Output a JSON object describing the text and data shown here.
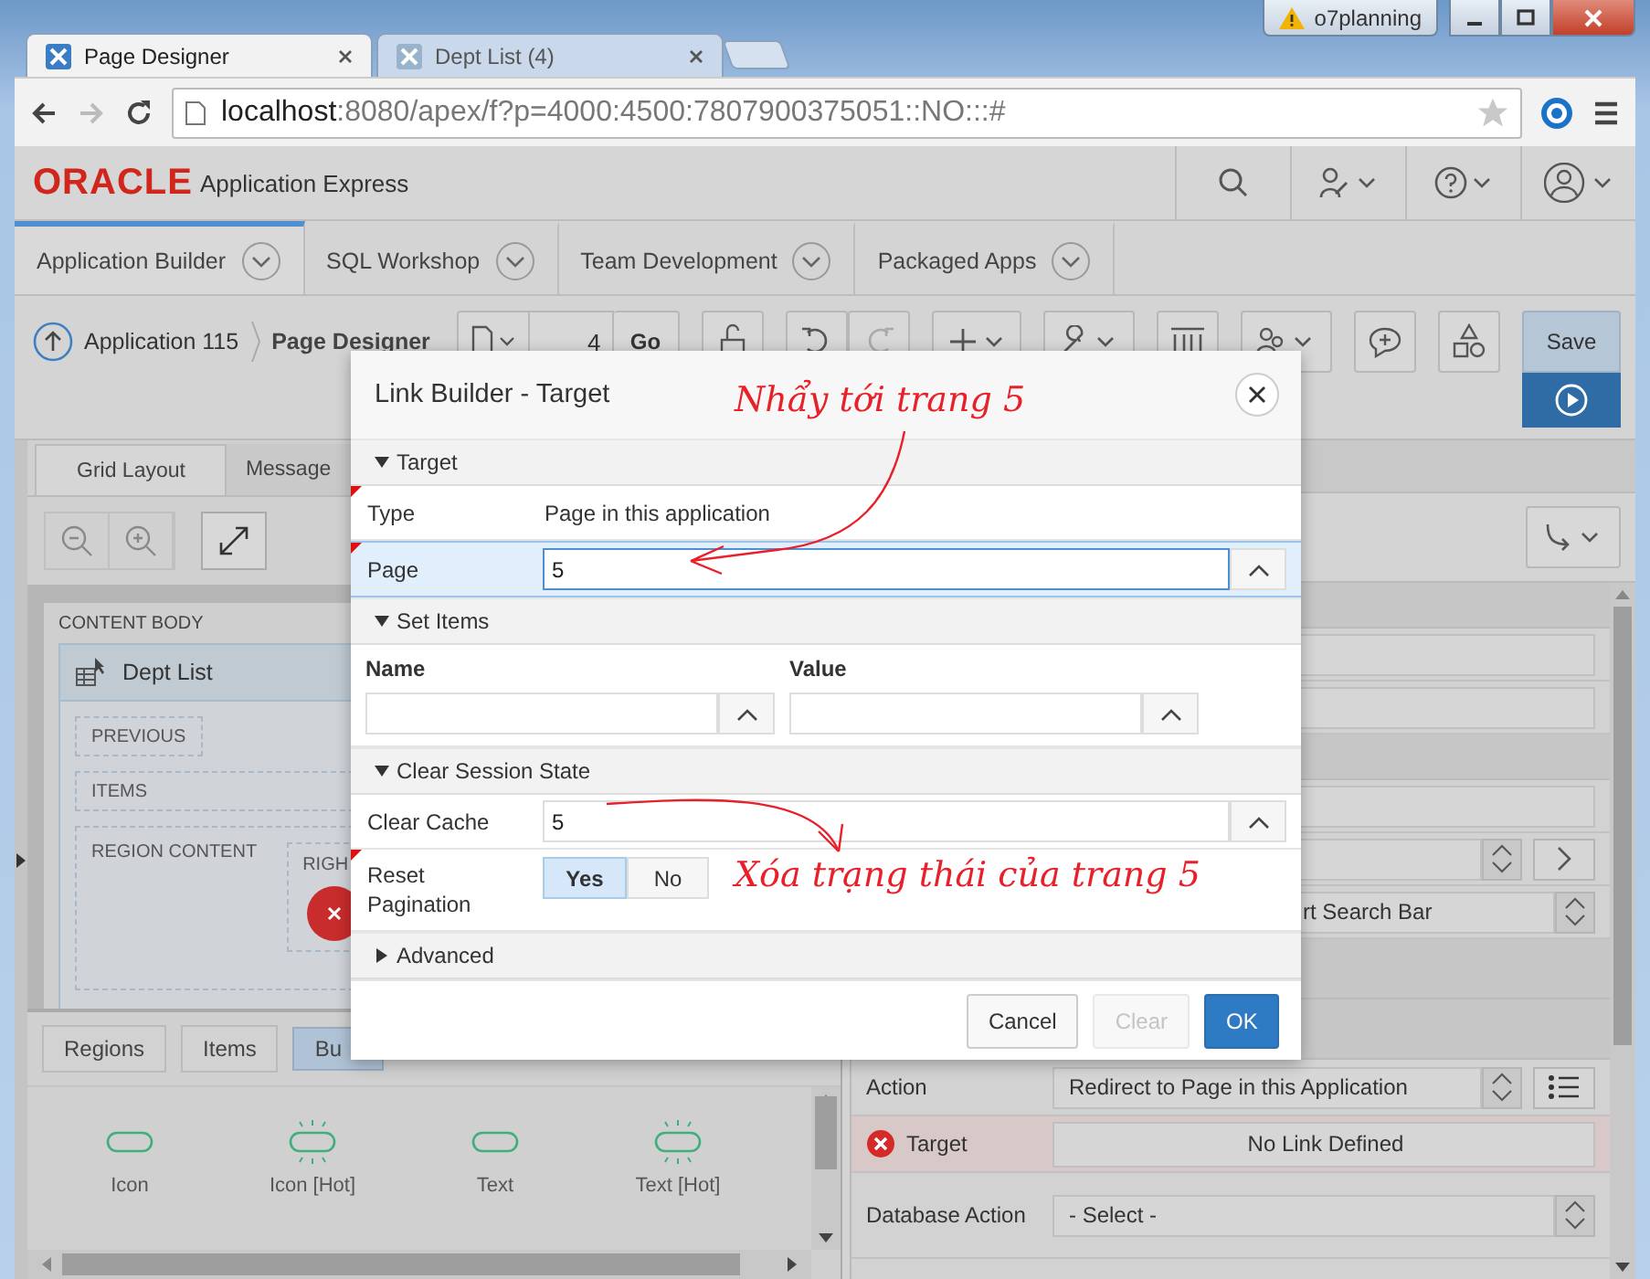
{
  "browser": {
    "tabs": [
      {
        "title": "Page Designer",
        "selected": true
      },
      {
        "title": "Dept List (4)",
        "selected": false
      }
    ],
    "profile_badge": "o7planning",
    "address": {
      "host": "localhost",
      "path": ":8080/apex/f?p=4000:4500:7807900375051::NO:::#"
    }
  },
  "header": {
    "logo": "ORACLE",
    "product": "Application Express"
  },
  "nav_tabs": [
    {
      "label": "Application Builder",
      "selected": true
    },
    {
      "label": "SQL Workshop",
      "selected": false
    },
    {
      "label": "Team Development",
      "selected": false
    },
    {
      "label": "Packaged Apps",
      "selected": false
    }
  ],
  "toolbar": {
    "breadcrumb": [
      "Application 115",
      "Page Designer"
    ],
    "page_number": "4",
    "go": "Go",
    "save": "Save"
  },
  "left_panel": {
    "tabs": [
      {
        "label": "Grid Layout",
        "selected": true
      },
      {
        "label": "Message",
        "selected": false
      }
    ],
    "layout": {
      "container": "CONTENT BODY",
      "region": "Dept List",
      "slots": [
        "PREVIOUS",
        "ITEMS",
        "REGION CONTENT"
      ],
      "sub_slot": "RIGH"
    },
    "gallery_tabs": [
      {
        "label": "Regions",
        "selected": false
      },
      {
        "label": "Items",
        "selected": false
      },
      {
        "label": "Bu",
        "selected": true
      }
    ],
    "gallery_items": [
      {
        "label": "Icon",
        "hot": false
      },
      {
        "label": "Icon [Hot]",
        "hot": true
      },
      {
        "label": "Text",
        "hot": false
      },
      {
        "label": "Text [Hot]",
        "hot": true
      }
    ]
  },
  "right_panel": {
    "partial_value": "rt Search Bar",
    "properties": [
      {
        "label": "Action",
        "kind": "select",
        "value": "Redirect to Page in this Application",
        "error": false
      },
      {
        "label": "Target",
        "kind": "link",
        "value": "No Link Defined",
        "error": true
      },
      {
        "label": "Database Action",
        "kind": "select",
        "value": "- Select -",
        "error": false
      }
    ]
  },
  "dialog": {
    "title": "Link Builder - Target",
    "sections": [
      {
        "title": "Target",
        "expanded": true,
        "kind": "fields",
        "fields": [
          {
            "label": "Type",
            "kind": "static",
            "value": "Page in this application",
            "required": true,
            "focused": false
          },
          {
            "label": "Page",
            "kind": "picker",
            "value": "5",
            "required": true,
            "focused": true
          }
        ]
      },
      {
        "title": "Set Items",
        "expanded": true,
        "kind": "items",
        "columns": [
          "Name",
          "Value"
        ]
      },
      {
        "title": "Clear Session State",
        "expanded": true,
        "kind": "fields",
        "fields": [
          {
            "label": "Clear Cache",
            "kind": "picker",
            "value": "5",
            "required": false,
            "focused": false
          },
          {
            "label": "Reset Pagination",
            "kind": "toggle",
            "required": true,
            "focused": false,
            "options": [
              {
                "label": "Yes",
                "selected": true
              },
              {
                "label": "No",
                "selected": false
              }
            ]
          }
        ]
      },
      {
        "title": "Advanced",
        "expanded": false
      }
    ],
    "buttons": [
      {
        "label": "Cancel",
        "kind": "default",
        "disabled": false
      },
      {
        "label": "Clear",
        "kind": "default",
        "disabled": true
      },
      {
        "label": "OK",
        "kind": "primary",
        "disabled": false
      }
    ]
  },
  "annotations": [
    {
      "text": "Nhẩy tới trang 5"
    },
    {
      "text": "Xóa trạng thái của trang 5"
    }
  ]
}
